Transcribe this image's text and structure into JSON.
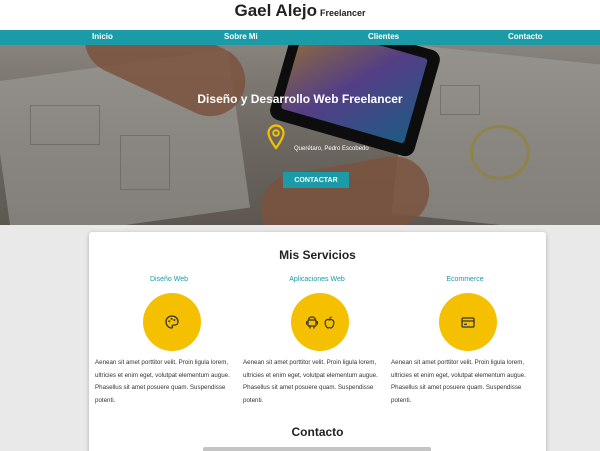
{
  "header": {
    "name": "Gael Alejo",
    "subtitle": "Freelancer"
  },
  "nav": {
    "items": [
      "Inicio",
      "Sobre Mi",
      "Clientes",
      "Contacto"
    ]
  },
  "hero": {
    "title": "Diseño y Desarrollo Web Freelancer",
    "location": "Querétaro, Pedro Escobedo",
    "cta": "CONTACTAR",
    "location_icon": "map-pin-icon"
  },
  "services": {
    "title": "Mis Servicios",
    "items": [
      {
        "name": "Diseño Web",
        "icons": [
          "palette-icon"
        ],
        "text": "Aenean sit amet porttitor velit. Proin ligula lorem, ultricies et enim eget, volutpat elementum augue. Phasellus sit amet posuere quam. Suspendisse potenti."
      },
      {
        "name": "Aplicaciones Web",
        "icons": [
          "android-icon",
          "apple-icon"
        ],
        "text": "Aenean sit amet porttitor velit. Proin ligula lorem, ultricies et enim eget, volutpat elementum augue. Phasellus sit amet posuere quam. Suspendisse potenti."
      },
      {
        "name": "Ecommerce",
        "icons": [
          "credit-card-icon"
        ],
        "text": "Aenean sit amet porttitor velit. Proin ligula lorem, ultricies et enim eget, volutpat elementum augue. Phasellus sit amet posuere quam. Suspendisse potenti."
      }
    ]
  },
  "contact": {
    "title": "Contacto"
  },
  "colors": {
    "accent": "#1a9ba7",
    "icon_circle": "#f5c000",
    "pin": "#f5c000"
  }
}
